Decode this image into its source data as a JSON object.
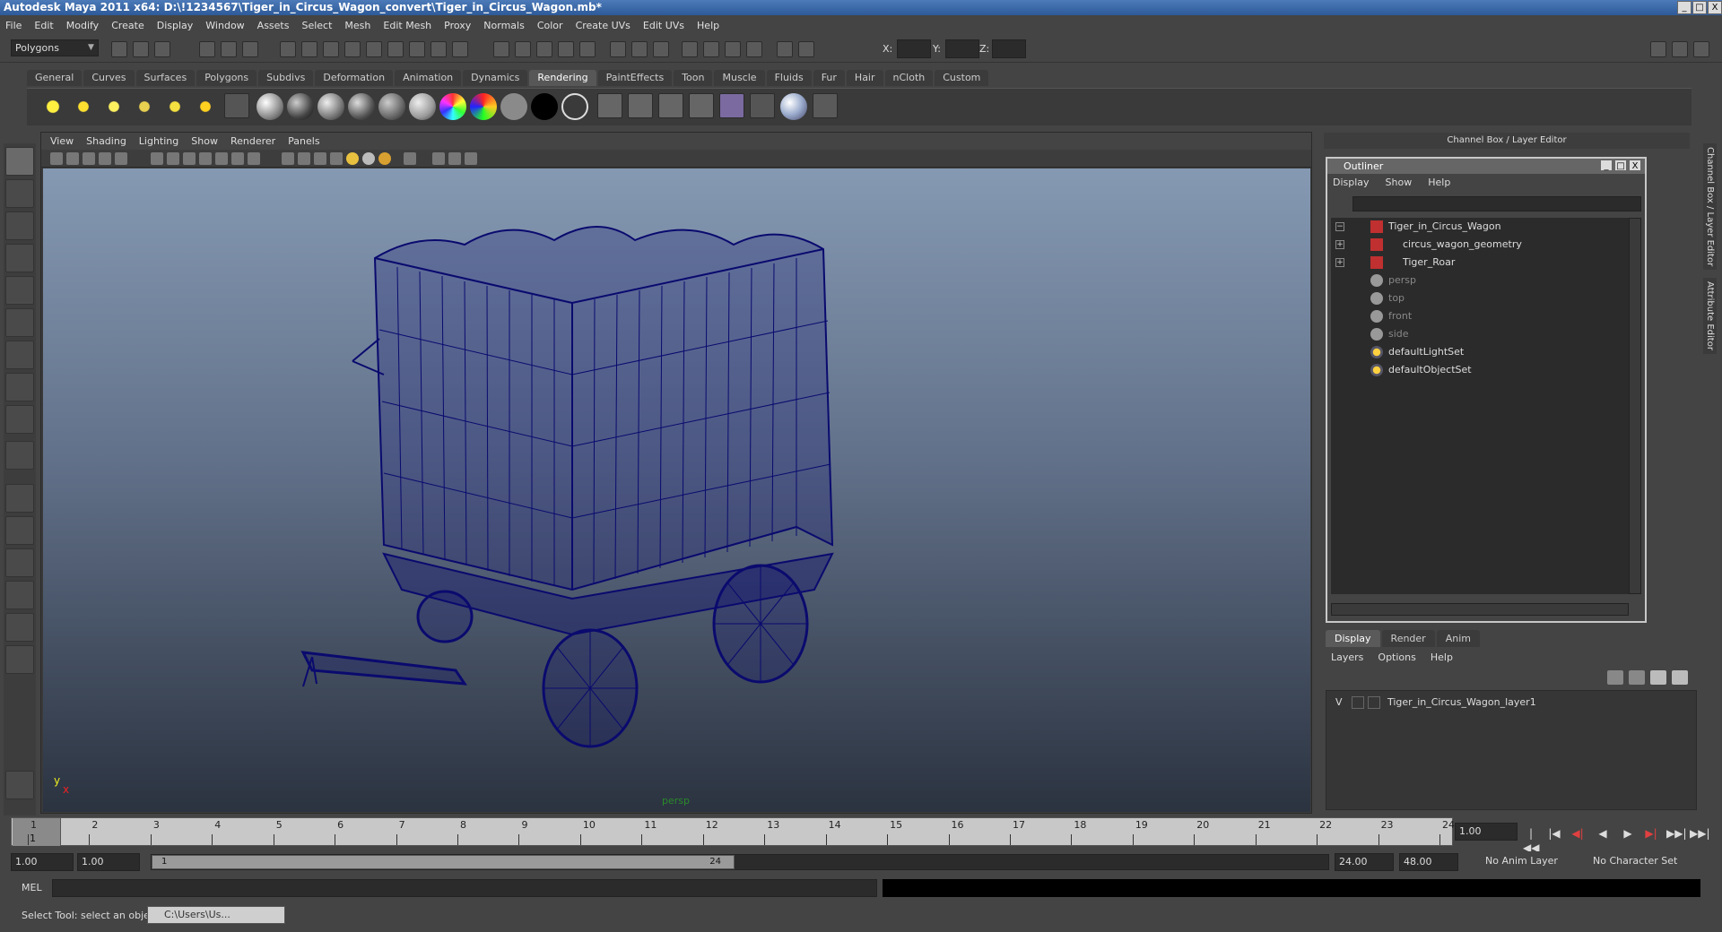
{
  "window": {
    "title": "Autodesk Maya 2011 x64: D:\\!1234567\\Tiger_in_Circus_Wagon_convert\\Tiger_in_Circus_Wagon.mb*",
    "minimize": "_",
    "restore": "□",
    "close": "X"
  },
  "menubar": [
    "File",
    "Edit",
    "Modify",
    "Create",
    "Display",
    "Window",
    "Assets",
    "Select",
    "Mesh",
    "Edit Mesh",
    "Proxy",
    "Normals",
    "Color",
    "Create UVs",
    "Edit UVs",
    "Help"
  ],
  "statusline": {
    "mode": "Polygons",
    "coord_labels": [
      "X:",
      "Y:",
      "Z:"
    ]
  },
  "shelf": {
    "tabs": [
      "General",
      "Curves",
      "Surfaces",
      "Polygons",
      "Subdivs",
      "Deformation",
      "Animation",
      "Dynamics",
      "Rendering",
      "PaintEffects",
      "Toon",
      "Muscle",
      "Fluids",
      "Fur",
      "Hair",
      "nCloth",
      "Custom"
    ],
    "active_tab": "Rendering"
  },
  "viewport": {
    "menu": [
      "View",
      "Shading",
      "Lighting",
      "Show",
      "Renderer",
      "Panels"
    ],
    "camera_label": "persp",
    "axis_y": "y",
    "axis_x": "x"
  },
  "rightdock": {
    "header": "Channel Box / Layer Editor",
    "vertical_tabs": [
      "Channel Box / Layer Editor",
      "Attribute Editor"
    ]
  },
  "outliner": {
    "title": "Outliner",
    "menu": [
      "Display",
      "Show",
      "Help"
    ],
    "items": [
      {
        "label": "Tiger_in_Circus_Wagon",
        "expand": "−",
        "dim": false,
        "icon": "mesh-transform-icon"
      },
      {
        "label": "circus_wagon_geometry",
        "expand": "+",
        "dim": false,
        "icon": "mesh-transform-icon"
      },
      {
        "label": "Tiger_Roar",
        "expand": "+",
        "dim": false,
        "icon": "mesh-transform-icon"
      },
      {
        "label": "persp",
        "expand": "",
        "dim": true,
        "icon": "camera-icon"
      },
      {
        "label": "top",
        "expand": "",
        "dim": true,
        "icon": "camera-icon"
      },
      {
        "label": "front",
        "expand": "",
        "dim": true,
        "icon": "camera-icon"
      },
      {
        "label": "side",
        "expand": "",
        "dim": true,
        "icon": "camera-icon"
      },
      {
        "label": "defaultLightSet",
        "expand": "",
        "dim": false,
        "icon": "set-icon"
      },
      {
        "label": "defaultObjectSet",
        "expand": "",
        "dim": false,
        "icon": "set-icon"
      }
    ]
  },
  "layers": {
    "tabs": [
      "Display",
      "Render",
      "Anim"
    ],
    "active_tab": "Display",
    "menu": [
      "Layers",
      "Options",
      "Help"
    ],
    "rows": [
      {
        "visibility": "V",
        "name": "Tiger_in_Circus_Wagon_layer1"
      }
    ]
  },
  "timeline": {
    "ticks": [
      "1",
      "2",
      "3",
      "4",
      "5",
      "6",
      "7",
      "8",
      "9",
      "10",
      "11",
      "12",
      "13",
      "14",
      "15",
      "16",
      "17",
      "18",
      "19",
      "20",
      "21",
      "22",
      "23",
      "24"
    ],
    "current_frame": "1",
    "current_time": "1.00",
    "playback_buttons": [
      "|◀◀",
      "|◀",
      "◀|",
      "◀",
      "▶",
      "▶|",
      "▶▶|",
      "▶▶|"
    ]
  },
  "range": {
    "start_time": "1.00",
    "playback_start": "1.00",
    "slider_start": "1",
    "slider_end": "24",
    "playback_end": "24.00",
    "end_time": "48.00",
    "anim_layer": "No Anim Layer",
    "character_set": "No Character Set"
  },
  "command": {
    "label": "MEL"
  },
  "help": {
    "text": "Select Tool: select an object",
    "taskbar_item": "C:\\Users\\Us..."
  },
  "colors": {
    "wireframe": "#0a0a6e",
    "viewport_top": "#8599b2",
    "viewport_bottom": "#2b3340",
    "title_bar": "#2d5a98"
  }
}
